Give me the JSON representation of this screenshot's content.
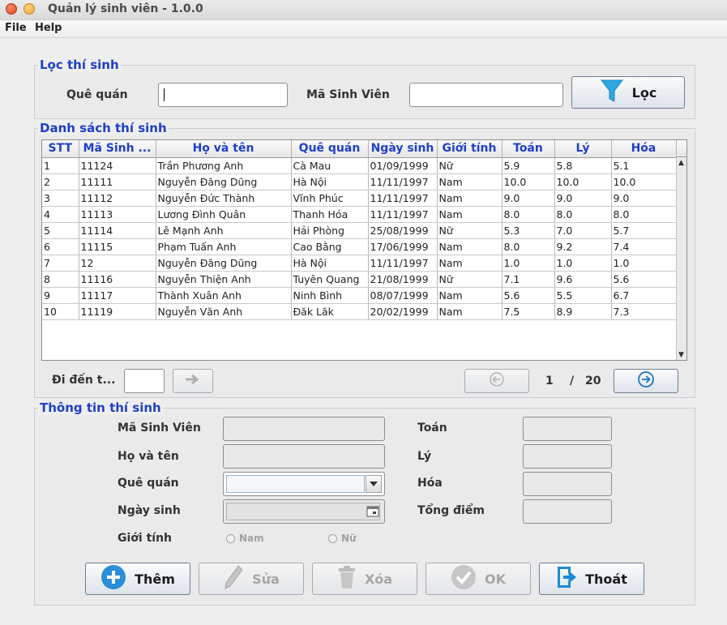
{
  "window": {
    "title": "Quản lý sinh viên - 1.0.0"
  },
  "menu": {
    "file": "File",
    "help": "Help"
  },
  "filter": {
    "title": "Lọc thí sinh",
    "hometown_label": "Quê quán",
    "student_id_label": "Mã Sinh Viên",
    "hometown_value": "",
    "student_id_value": "",
    "filter_button": "Lọc"
  },
  "list": {
    "title": "Danh sách thí sinh",
    "columns": [
      "STT",
      "Mã Sinh ...",
      "Họ và tên",
      "Quê quán",
      "Ngày sinh",
      "Giới tính",
      "Toán",
      "Lý",
      "Hóa"
    ],
    "rows": [
      [
        "1",
        "11124",
        "Trần Phương Anh",
        "Cà Mau",
        "01/09/1999",
        "Nữ",
        "5.9",
        "5.8",
        "5.1"
      ],
      [
        "2",
        "11111",
        "Nguyễn Đăng Dũng",
        "Hà Nội",
        "11/11/1997",
        "Nam",
        "10.0",
        "10.0",
        "10.0"
      ],
      [
        "3",
        "11112",
        "Nguyễn Đức Thành",
        "Vĩnh Phúc",
        "11/11/1997",
        "Nam",
        "9.0",
        "9.0",
        "9.0"
      ],
      [
        "4",
        "11113",
        "Lương Đình Quân",
        "Thanh Hóa",
        "11/11/1997",
        "Nam",
        "8.0",
        "8.0",
        "8.0"
      ],
      [
        "5",
        "11114",
        "Lê Mạnh Anh",
        "Hải Phòng",
        "25/08/1999",
        "Nữ",
        "5.3",
        "7.0",
        "5.7"
      ],
      [
        "6",
        "11115",
        "Phạm Tuấn Anh",
        "Cao Bằng",
        "17/06/1999",
        "Nam",
        "8.0",
        "9.2",
        "7.4"
      ],
      [
        "7",
        "12",
        "Nguyễn Đăng Dũng",
        "Hà Nội",
        "11/11/1997",
        "Nam",
        "1.0",
        "1.0",
        "1.0"
      ],
      [
        "8",
        "11116",
        "Nguyễn Thiện Anh",
        "Tuyên Quang",
        "21/08/1999",
        "Nữ",
        "7.1",
        "9.6",
        "5.6"
      ],
      [
        "9",
        "11117",
        "Thành Xuân Anh",
        "Ninh Bình",
        "08/07/1999",
        "Nam",
        "5.6",
        "5.5",
        "6.7"
      ],
      [
        "10",
        "11119",
        "Nguyễn Văn Anh",
        "Đăk Lăk",
        "20/02/1999",
        "Nam",
        "7.5",
        "8.9",
        "7.3"
      ]
    ],
    "goto_label": "Đi đến t...",
    "goto_value": "",
    "current_page": "1",
    "page_separator": "/",
    "total_pages": "20"
  },
  "info": {
    "title": "Thông tin thí sinh",
    "student_id_label": "Mã Sinh Viên",
    "name_label": "Họ và tên",
    "hometown_label": "Quê quán",
    "dob_label": "Ngày sinh",
    "gender_label": "Giới tính",
    "gender_male": "Nam",
    "gender_female": "Nữ",
    "math_label": "Toán",
    "physics_label": "Lý",
    "chemistry_label": "Hóa",
    "total_label": "Tổng điểm"
  },
  "actions": {
    "add": "Thêm",
    "edit": "Sửa",
    "delete": "Xóa",
    "ok": "OK",
    "exit": "Thoát"
  },
  "colors": {
    "accent": "#1f3fc8",
    "add_icon": "#2b8ed8",
    "filter_icon": "#2ea7e0",
    "exit_icon": "#1f8ad3"
  }
}
